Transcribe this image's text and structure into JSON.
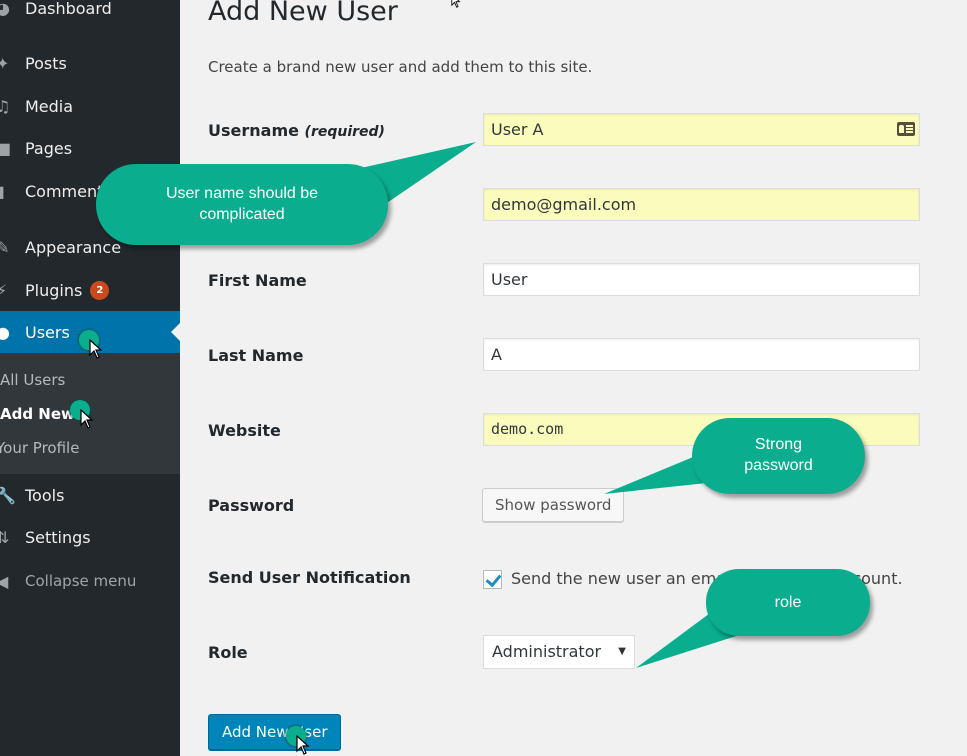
{
  "sidebar": {
    "items": [
      {
        "label": "Dashboard",
        "icon": "dashboard-icon"
      },
      {
        "label": "Posts",
        "icon": "pin-icon"
      },
      {
        "label": "Media",
        "icon": "media-icon"
      },
      {
        "label": "Pages",
        "icon": "page-icon"
      },
      {
        "label": "Comments",
        "icon": "comment-icon"
      },
      {
        "label": "Appearance",
        "icon": "brush-icon"
      },
      {
        "label": "Plugins",
        "icon": "plugin-icon",
        "badge": "2"
      },
      {
        "label": "Users",
        "icon": "user-icon",
        "active": true
      },
      {
        "label": "Tools",
        "icon": "wrench-icon"
      },
      {
        "label": "Settings",
        "icon": "settings-icon"
      }
    ],
    "submenu": [
      {
        "label": "All Users"
      },
      {
        "label": "Add New",
        "current": true
      },
      {
        "label": "Your Profile"
      }
    ],
    "collapse_label": "Collapse menu"
  },
  "page": {
    "title": "Add New User",
    "intro": "Create a brand new user and add them to this site."
  },
  "form": {
    "username": {
      "label": "Username",
      "note": "(required)",
      "value": "User A"
    },
    "email": {
      "value": "demo@gmail.com"
    },
    "first_name": {
      "label": "First Name",
      "value": "User"
    },
    "last_name": {
      "label": "Last Name",
      "value": "A"
    },
    "website": {
      "label": "Website",
      "value": "demo.com"
    },
    "password": {
      "label": "Password",
      "button": "Show password"
    },
    "notification": {
      "label": "Send User Notification",
      "checkbox_text": "Send the new user an email about their account.",
      "checked": true
    },
    "role": {
      "label": "Role",
      "value": "Administrator"
    },
    "submit_label": "Add New User"
  },
  "callouts": {
    "username": "User name should be complicated",
    "password": "Strong password",
    "role": "role"
  },
  "colors": {
    "sidebar_bg": "#23282d",
    "active_menu": "#0073aa",
    "callout": "#0aae8e",
    "autofill": "#fafcbc",
    "primary_button": "#0085ba",
    "badge": "#ca4a1f"
  }
}
